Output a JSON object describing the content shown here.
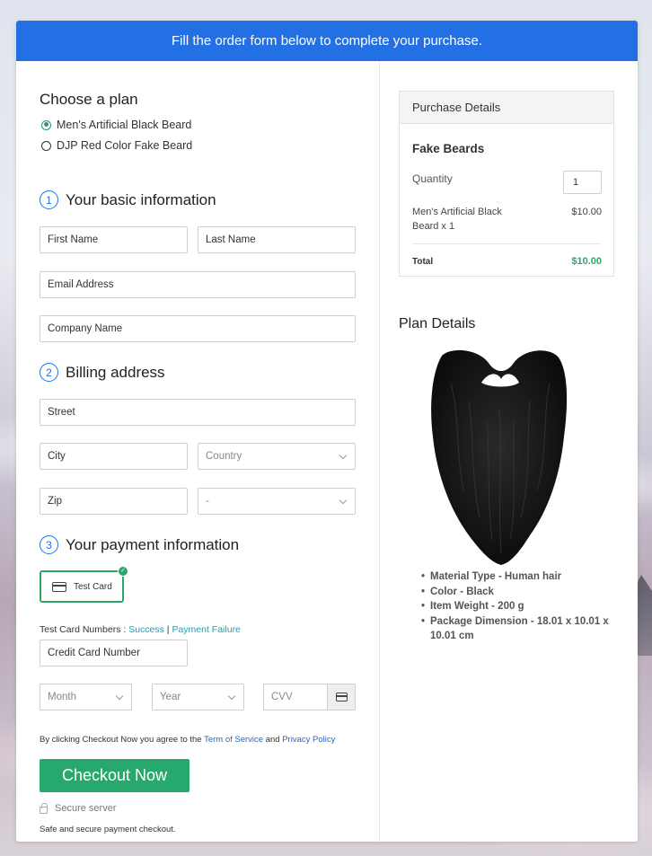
{
  "banner": {
    "text": "Fill the order form below to complete your purchase."
  },
  "plan": {
    "heading": "Choose a plan",
    "options": [
      {
        "label": "Men's Artificial Black Beard",
        "selected": true
      },
      {
        "label": "DJP Red Color Fake Beard",
        "selected": false
      }
    ]
  },
  "basic_info": {
    "step": "1",
    "heading": "Your basic information",
    "first_name": "First Name",
    "last_name": "Last Name",
    "email": "Email Address",
    "company": "Company Name"
  },
  "billing": {
    "step": "2",
    "heading": "Billing address",
    "street": "Street",
    "city": "City",
    "country": "Country",
    "zip": "Zip",
    "state": "-"
  },
  "payment": {
    "step": "3",
    "heading": "Your payment information",
    "test_card_label": "Test Card",
    "test_numbers_prefix": "Test Card Numbers : ",
    "success_link": "Success",
    "separator": " | ",
    "failure_link": "Payment Failure",
    "card_number": "Credit Card Number",
    "month": "Month",
    "year": "Year",
    "cvv": "CVV"
  },
  "agreement": {
    "prefix": "By clicking Checkout Now you agree to the ",
    "terms_link": "Term of Service",
    "and": " and ",
    "privacy_link": "Privacy Policy"
  },
  "checkout": {
    "button": "Checkout Now",
    "secure": "Secure server",
    "safe": "Safe and secure payment checkout."
  },
  "purchase": {
    "heading": "Purchase Details",
    "product": "Fake Beards",
    "quantity_label": "Quantity",
    "quantity_value": "1",
    "item_name": "Men's Artificial Black Beard x 1",
    "item_price": "$10.00",
    "total_label": "Total",
    "total_value": "$10.00"
  },
  "plan_details": {
    "heading": "Plan Details",
    "bullets": [
      "Material Type - Human hair",
      "Color - Black",
      "Item Weight  - 200 g",
      "Package Dimension - 18.01 x 10.01 x 10.01 cm"
    ]
  },
  "colors": {
    "banner": "#2370e4",
    "checkout": "#27a86e",
    "total": "#27a86e",
    "link": "#1aa3b8"
  },
  "icons": [
    "radio-icon",
    "credit-card-icon",
    "check-icon",
    "chevron-down-icon",
    "lock-icon"
  ]
}
